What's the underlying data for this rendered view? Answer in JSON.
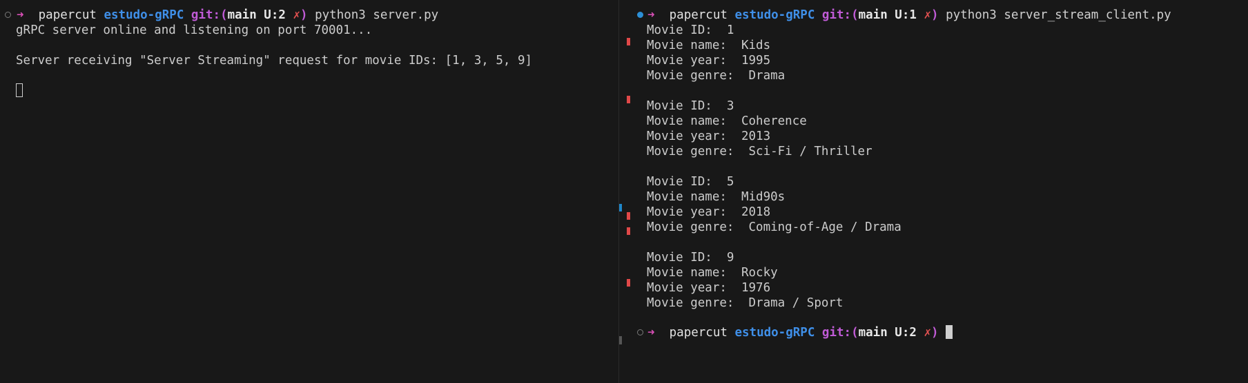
{
  "left_terminal": {
    "prompt": {
      "arrow": "➜",
      "user": "papercut",
      "dir": "estudo-gRPC",
      "git_label": "git:(",
      "branch": "main U:2",
      "dirty": "✗",
      "close": ")",
      "command": "python3 server.py"
    },
    "lines": [
      "gRPC server online and listening on port 70001...",
      "",
      "Server receiving \"Server Streaming\" request for movie IDs: [1, 3, 5, 9]"
    ]
  },
  "right_terminal": {
    "prompt": {
      "arrow": "➜",
      "user": "papercut",
      "dir": "estudo-gRPC",
      "git_label": "git:(",
      "branch": "main U:1",
      "dirty": "✗",
      "close": ")",
      "command": "python3 server_stream_client.py"
    },
    "lines": [
      "Movie ID:  1",
      "Movie name:  Kids",
      "Movie year:  1995",
      "Movie genre:  Drama",
      "",
      "Movie ID:  3",
      "Movie name:  Coherence",
      "Movie year:  2013",
      "Movie genre:  Sci-Fi / Thriller",
      "",
      "Movie ID:  5",
      "Movie name:  Mid90s",
      "Movie year:  2018",
      "Movie genre:  Coming-of-Age / Drama",
      "",
      "Movie ID:  9",
      "Movie name:  Rocky",
      "Movie year:  1976",
      "Movie genre:  Drama / Sport"
    ],
    "final_prompt": {
      "arrow": "➜",
      "user": "papercut",
      "dir": "estudo-gRPC",
      "git_label": "git:(",
      "branch": "main U:2",
      "dirty": "✗",
      "close": ")"
    }
  },
  "colors": {
    "background": "#181818",
    "arrow": "#d74fb5",
    "directory": "#3f8fe8",
    "git": "#c05bd6",
    "dirty": "#e05050",
    "active_dot": "#2c8fd6"
  }
}
